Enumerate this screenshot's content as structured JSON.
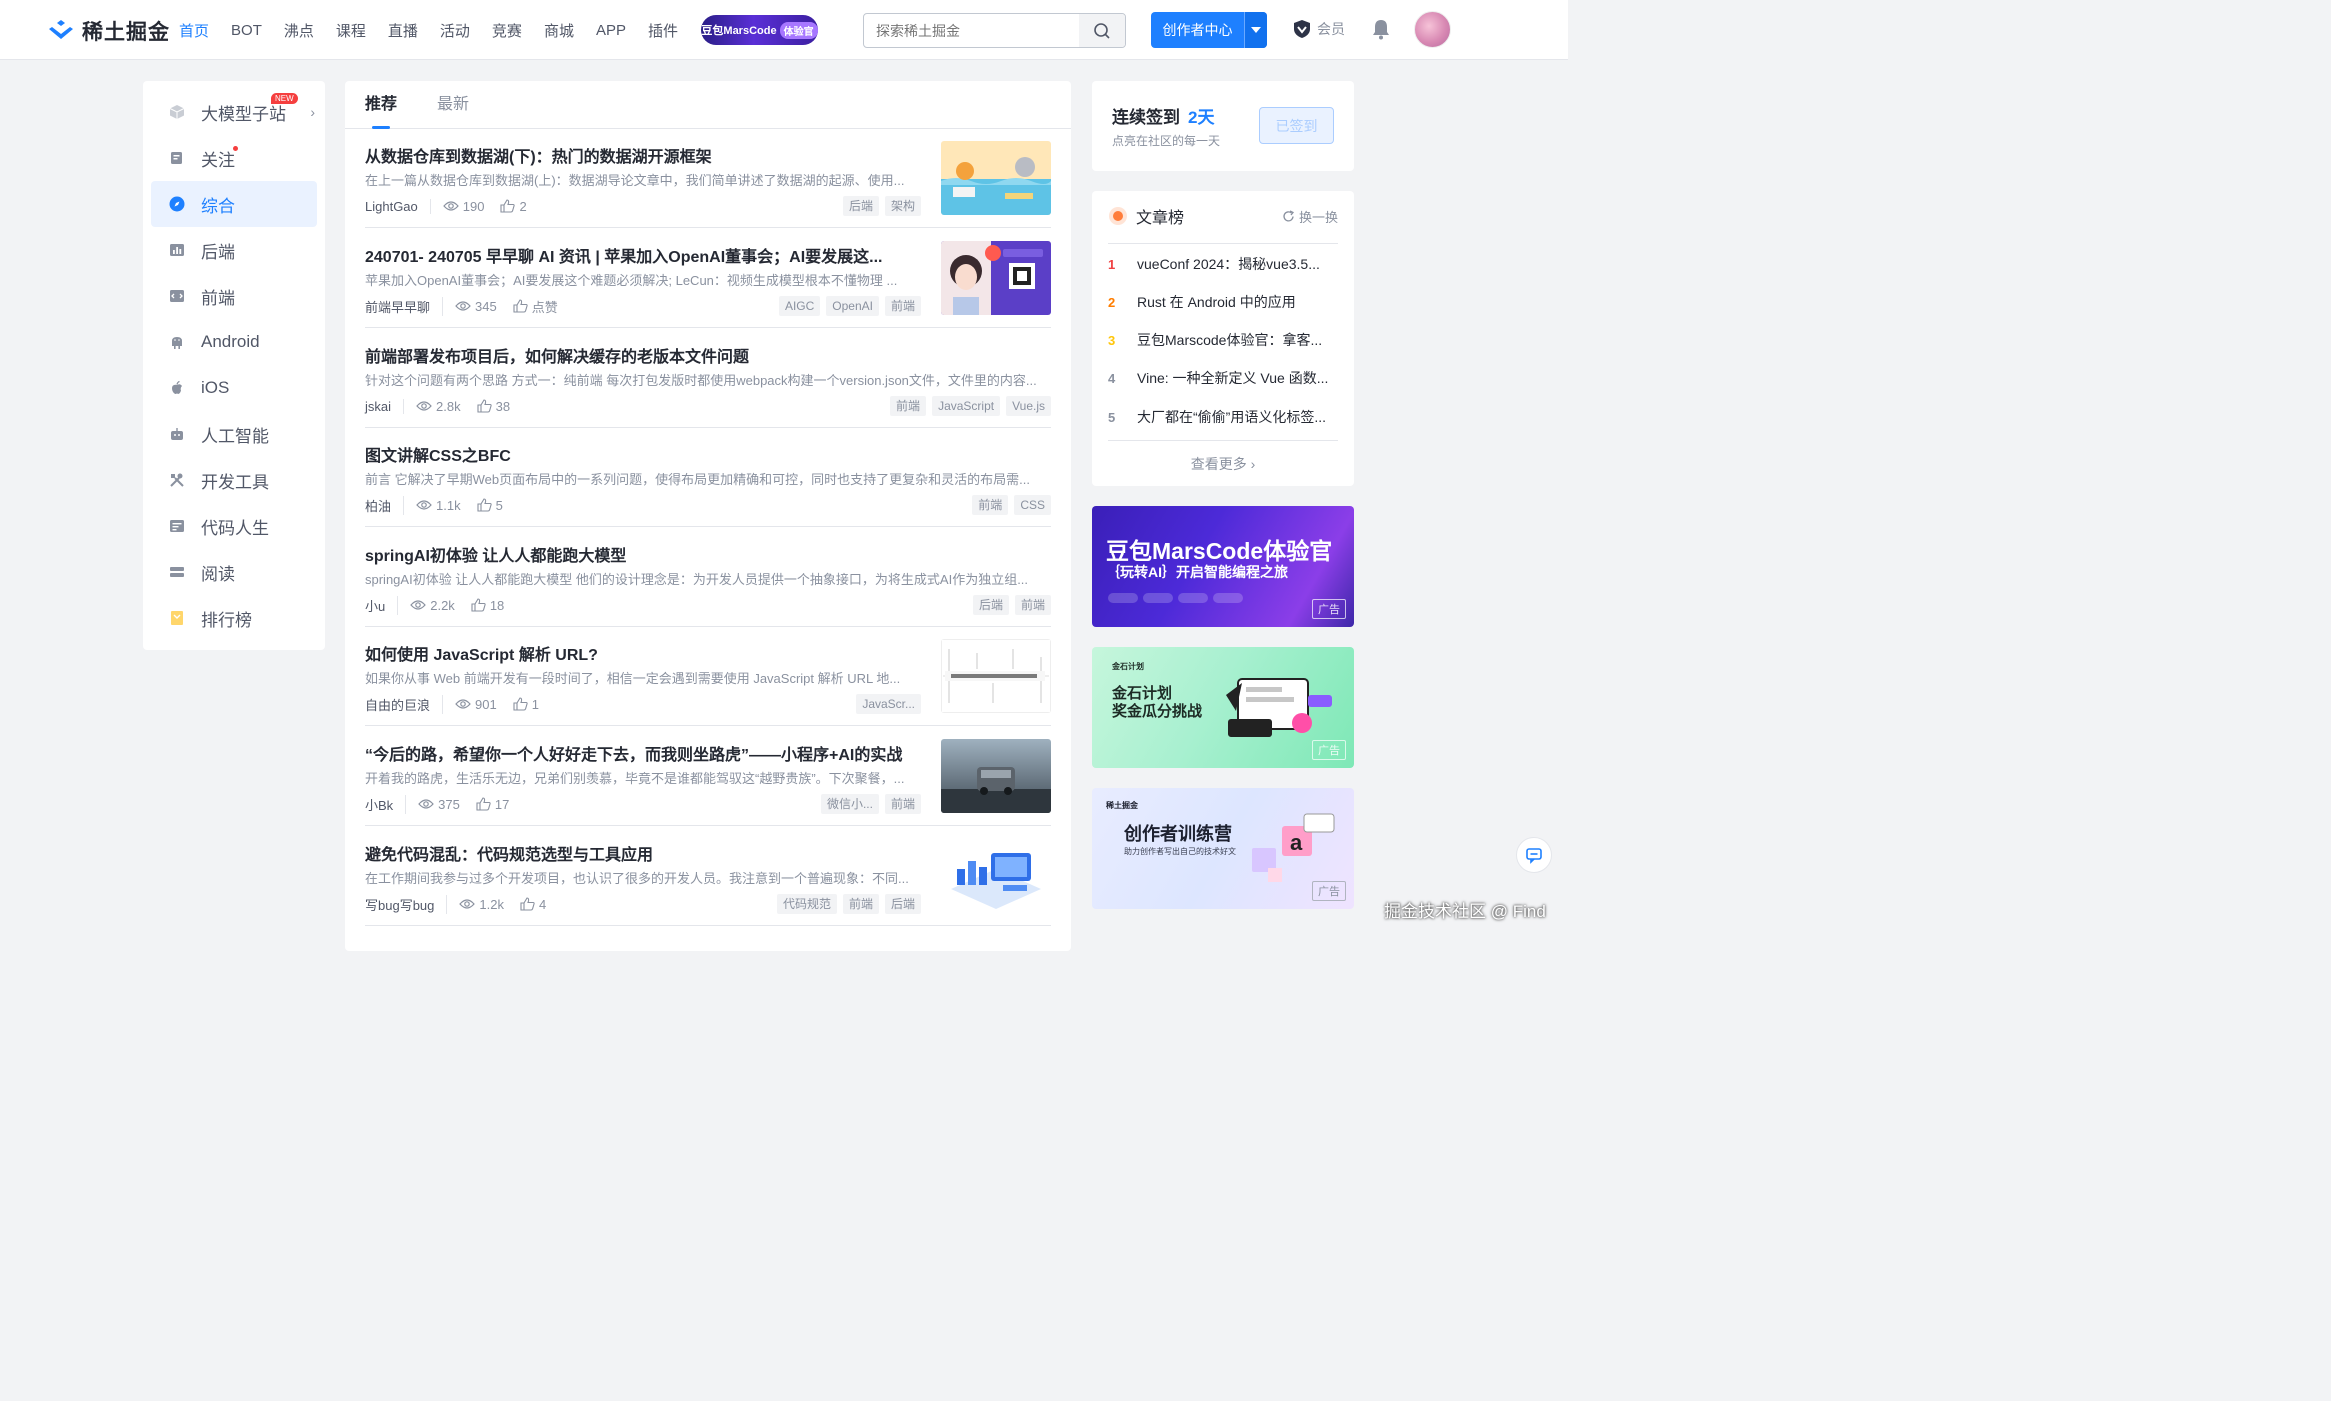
{
  "header": {
    "logo_text": "稀土掘金",
    "nav": [
      "首页",
      "BOT",
      "沸点",
      "课程",
      "直播",
      "活动",
      "竞赛",
      "商城",
      "APP",
      "插件"
    ],
    "marscode_badge": {
      "text": "豆包MarsCode",
      "tag": "体验官"
    },
    "search_placeholder": "探索稀土掘金",
    "creator_button": "创作者中心",
    "vip_label": "会员"
  },
  "sidebar": {
    "items": [
      {
        "label": "大模型子站",
        "icon": "cube-icon",
        "badge": "NEW"
      },
      {
        "label": "关注",
        "icon": "follow-icon"
      },
      {
        "label": "综合",
        "icon": "compass-icon"
      },
      {
        "label": "后端",
        "icon": "backend-icon"
      },
      {
        "label": "前端",
        "icon": "frontend-icon"
      },
      {
        "label": "Android",
        "icon": "android-icon"
      },
      {
        "label": "iOS",
        "icon": "apple-icon"
      },
      {
        "label": "人工智能",
        "icon": "robot-icon"
      },
      {
        "label": "开发工具",
        "icon": "tools-icon"
      },
      {
        "label": "代码人生",
        "icon": "code-life-icon"
      },
      {
        "label": "阅读",
        "icon": "reading-icon"
      },
      {
        "label": "排行榜",
        "icon": "ranking-icon"
      }
    ]
  },
  "feed": {
    "tabs": [
      "推荐",
      "最新"
    ],
    "articles": [
      {
        "title": "从数据仓库到数据湖(下)：热门的数据湖开源框架",
        "abstract": "在上一篇从数据仓库到数据湖(上)：数据湖导论文章中，我们简单讲述了数据湖的起源、使用...",
        "author": "LightGao",
        "views": "190",
        "likes": "2",
        "tags": [
          "后端",
          "架构"
        ]
      },
      {
        "title": "240701- 240705 早早聊 AI 资讯 | 苹果加入OpenAI董事会；AI要发展这...",
        "abstract": "苹果加入OpenAI董事会；AI要发展这个难题必须解决; LeCun：视频生成模型根本不懂物理 ...",
        "author": "前端早早聊",
        "views": "345",
        "likes": "点赞",
        "tags": [
          "AIGC",
          "OpenAI",
          "前端"
        ]
      },
      {
        "title": "前端部署发布项目后，如何解决缓存的老版本文件问题",
        "abstract": "针对这个问题有两个思路 方式一：纯前端 每次打包发版时都使用webpack构建一个version.json文件，文件里的内容...",
        "author": "jskai",
        "views": "2.8k",
        "likes": "38",
        "tags": [
          "前端",
          "JavaScript",
          "Vue.js"
        ]
      },
      {
        "title": "图文讲解CSS之BFC",
        "abstract": "前言 它解决了早期Web页面布局中的一系列问题，使得布局更加精确和可控，同时也支持了更复杂和灵活的布局需...",
        "author": "柏油",
        "views": "1.1k",
        "likes": "5",
        "tags": [
          "前端",
          "CSS"
        ]
      },
      {
        "title": "springAI初体验 让人人都能跑大模型",
        "abstract": "springAI初体验 让人人都能跑大模型 他们的设计理念是：为开发人员提供一个抽象接口，为将生成式AI作为独立组...",
        "author": "小u",
        "views": "2.2k",
        "likes": "18",
        "tags": [
          "后端",
          "前端"
        ]
      },
      {
        "title": "如何使用 JavaScript 解析 URL?",
        "abstract": "如果你从事 Web 前端开发有一段时间了，相信一定会遇到需要使用 JavaScript 解析 URL 地...",
        "author": "自由的巨浪",
        "views": "901",
        "likes": "1",
        "tags": [
          "JavaScr..."
        ]
      },
      {
        "title": "“今后的路，希望你一个人好好走下去，而我则坐路虎”——小程序+AI的实战",
        "abstract": "开着我的路虎，生活乐无边，兄弟们别羡慕，毕竟不是谁都能驾驭这“越野贵族”。下次聚餐，...",
        "author": "小Bk",
        "views": "375",
        "likes": "17",
        "tags": [
          "微信小...",
          "前端"
        ]
      },
      {
        "title": "避免代码混乱：代码规范选型与工具应用",
        "abstract": "在工作期间我参与过多个开发项目，也认识了很多的开发人员。我注意到一个普遍现象：不同...",
        "author": "写bug写bug",
        "views": "1.2k",
        "likes": "4",
        "tags": [
          "代码规范",
          "前端",
          "后端"
        ]
      }
    ]
  },
  "signin": {
    "title": "连续签到",
    "days": "2天",
    "subtitle": "点亮在社区的每一天",
    "button": "已签到"
  },
  "rank": {
    "title": "文章榜",
    "refresh": "换一换",
    "items": [
      {
        "num": "1",
        "text": "vueConf 2024：揭秘vue3.5..."
      },
      {
        "num": "2",
        "text": "Rust 在 Android 中的应用"
      },
      {
        "num": "3",
        "text": "豆包Marscode体验官：拿客..."
      },
      {
        "num": "4",
        "text": "Vine: 一种全新定义 Vue 函数..."
      },
      {
        "num": "5",
        "text": "大厂都在“偷偷”用语义化标签..."
      }
    ],
    "more": "查看更多 ›"
  },
  "ads": {
    "ad1": {
      "headline": "豆包MarsCode体验官",
      "sub": "｛玩转AI｝开启智能编程之旅",
      "tag": "广告"
    },
    "ad2": {
      "small": "金石计划",
      "headline1": "金石计划",
      "headline2": "奖金瓜分挑战",
      "tag": "广告"
    },
    "ad3": {
      "small": "稀土掘金",
      "headline": "创作者训练营",
      "sub": "助力创作者写出自己的技术好文",
      "tag": "广告"
    }
  },
  "watermark": "掘金技术社区 @ Find"
}
